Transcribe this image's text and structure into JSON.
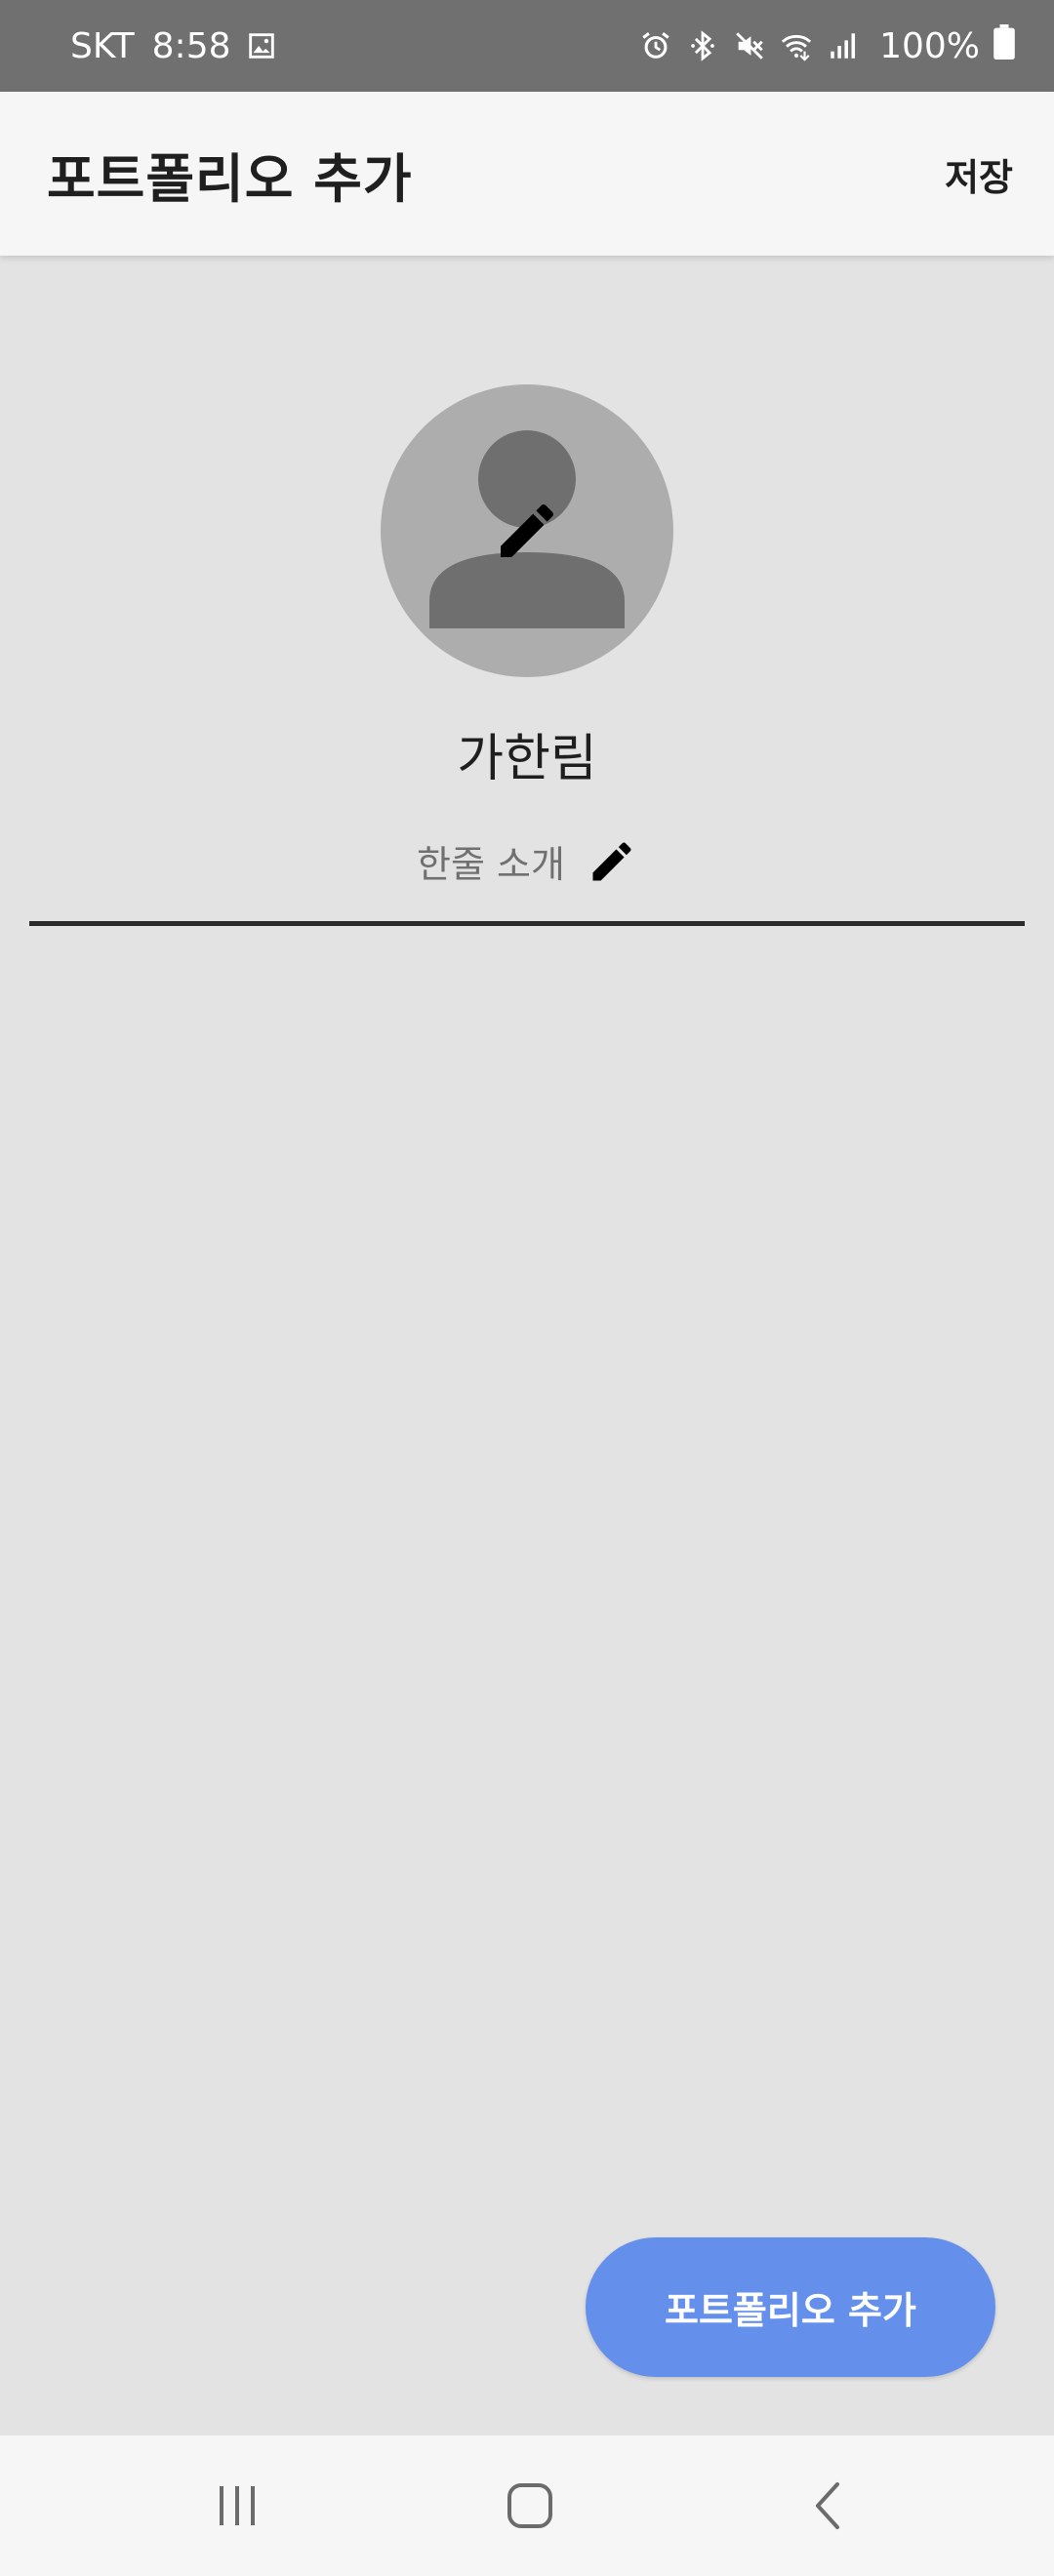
{
  "status_bar": {
    "carrier": "SKT",
    "time": "8:58",
    "battery": "100%",
    "icons": [
      "gallery-icon",
      "alarm-icon",
      "bluetooth-icon",
      "mute-icon",
      "wifi-icon",
      "signal-icon",
      "battery-icon"
    ]
  },
  "app_bar": {
    "title": "포트폴리오 추가",
    "save_label": "저장"
  },
  "profile": {
    "name": "가한림",
    "intro_placeholder": "한줄 소개"
  },
  "fab": {
    "label": "포트폴리오 추가",
    "color": "#6490ec"
  },
  "colors": {
    "status_bar": "#707070",
    "app_bar": "#f6f6f6",
    "background": "#e3e3e3",
    "avatar_bg": "#adadad",
    "avatar_fg": "#6f6f6f"
  }
}
